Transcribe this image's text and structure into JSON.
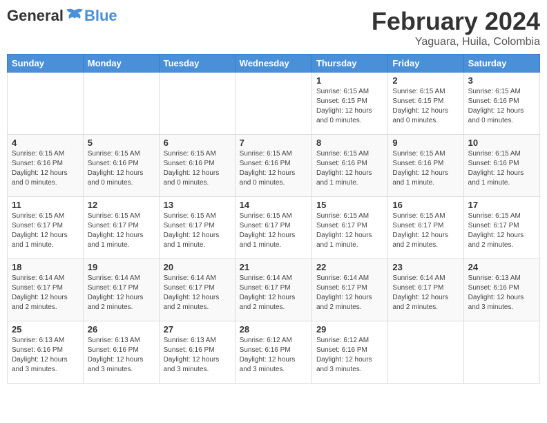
{
  "logo": {
    "general": "General",
    "blue": "Blue"
  },
  "title": "February 2024",
  "subtitle": "Yaguara, Huila, Colombia",
  "weekdays": [
    "Sunday",
    "Monday",
    "Tuesday",
    "Wednesday",
    "Thursday",
    "Friday",
    "Saturday"
  ],
  "weeks": [
    [
      {
        "day": "",
        "info": ""
      },
      {
        "day": "",
        "info": ""
      },
      {
        "day": "",
        "info": ""
      },
      {
        "day": "",
        "info": ""
      },
      {
        "day": "1",
        "info": "Sunrise: 6:15 AM\nSunset: 6:15 PM\nDaylight: 12 hours\nand 0 minutes."
      },
      {
        "day": "2",
        "info": "Sunrise: 6:15 AM\nSunset: 6:15 PM\nDaylight: 12 hours\nand 0 minutes."
      },
      {
        "day": "3",
        "info": "Sunrise: 6:15 AM\nSunset: 6:16 PM\nDaylight: 12 hours\nand 0 minutes."
      }
    ],
    [
      {
        "day": "4",
        "info": "Sunrise: 6:15 AM\nSunset: 6:16 PM\nDaylight: 12 hours\nand 0 minutes."
      },
      {
        "day": "5",
        "info": "Sunrise: 6:15 AM\nSunset: 6:16 PM\nDaylight: 12 hours\nand 0 minutes."
      },
      {
        "day": "6",
        "info": "Sunrise: 6:15 AM\nSunset: 6:16 PM\nDaylight: 12 hours\nand 0 minutes."
      },
      {
        "day": "7",
        "info": "Sunrise: 6:15 AM\nSunset: 6:16 PM\nDaylight: 12 hours\nand 0 minutes."
      },
      {
        "day": "8",
        "info": "Sunrise: 6:15 AM\nSunset: 6:16 PM\nDaylight: 12 hours\nand 1 minute."
      },
      {
        "day": "9",
        "info": "Sunrise: 6:15 AM\nSunset: 6:16 PM\nDaylight: 12 hours\nand 1 minute."
      },
      {
        "day": "10",
        "info": "Sunrise: 6:15 AM\nSunset: 6:16 PM\nDaylight: 12 hours\nand 1 minute."
      }
    ],
    [
      {
        "day": "11",
        "info": "Sunrise: 6:15 AM\nSunset: 6:17 PM\nDaylight: 12 hours\nand 1 minute."
      },
      {
        "day": "12",
        "info": "Sunrise: 6:15 AM\nSunset: 6:17 PM\nDaylight: 12 hours\nand 1 minute."
      },
      {
        "day": "13",
        "info": "Sunrise: 6:15 AM\nSunset: 6:17 PM\nDaylight: 12 hours\nand 1 minute."
      },
      {
        "day": "14",
        "info": "Sunrise: 6:15 AM\nSunset: 6:17 PM\nDaylight: 12 hours\nand 1 minute."
      },
      {
        "day": "15",
        "info": "Sunrise: 6:15 AM\nSunset: 6:17 PM\nDaylight: 12 hours\nand 1 minute."
      },
      {
        "day": "16",
        "info": "Sunrise: 6:15 AM\nSunset: 6:17 PM\nDaylight: 12 hours\nand 2 minutes."
      },
      {
        "day": "17",
        "info": "Sunrise: 6:15 AM\nSunset: 6:17 PM\nDaylight: 12 hours\nand 2 minutes."
      }
    ],
    [
      {
        "day": "18",
        "info": "Sunrise: 6:14 AM\nSunset: 6:17 PM\nDaylight: 12 hours\nand 2 minutes."
      },
      {
        "day": "19",
        "info": "Sunrise: 6:14 AM\nSunset: 6:17 PM\nDaylight: 12 hours\nand 2 minutes."
      },
      {
        "day": "20",
        "info": "Sunrise: 6:14 AM\nSunset: 6:17 PM\nDaylight: 12 hours\nand 2 minutes."
      },
      {
        "day": "21",
        "info": "Sunrise: 6:14 AM\nSunset: 6:17 PM\nDaylight: 12 hours\nand 2 minutes."
      },
      {
        "day": "22",
        "info": "Sunrise: 6:14 AM\nSunset: 6:17 PM\nDaylight: 12 hours\nand 2 minutes."
      },
      {
        "day": "23",
        "info": "Sunrise: 6:14 AM\nSunset: 6:17 PM\nDaylight: 12 hours\nand 2 minutes."
      },
      {
        "day": "24",
        "info": "Sunrise: 6:13 AM\nSunset: 6:16 PM\nDaylight: 12 hours\nand 3 minutes."
      }
    ],
    [
      {
        "day": "25",
        "info": "Sunrise: 6:13 AM\nSunset: 6:16 PM\nDaylight: 12 hours\nand 3 minutes."
      },
      {
        "day": "26",
        "info": "Sunrise: 6:13 AM\nSunset: 6:16 PM\nDaylight: 12 hours\nand 3 minutes."
      },
      {
        "day": "27",
        "info": "Sunrise: 6:13 AM\nSunset: 6:16 PM\nDaylight: 12 hours\nand 3 minutes."
      },
      {
        "day": "28",
        "info": "Sunrise: 6:12 AM\nSunset: 6:16 PM\nDaylight: 12 hours\nand 3 minutes."
      },
      {
        "day": "29",
        "info": "Sunrise: 6:12 AM\nSunset: 6:16 PM\nDaylight: 12 hours\nand 3 minutes."
      },
      {
        "day": "",
        "info": ""
      },
      {
        "day": "",
        "info": ""
      }
    ]
  ]
}
